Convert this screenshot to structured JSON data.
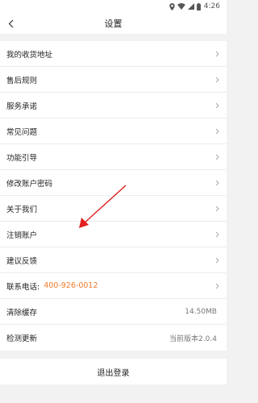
{
  "status_bar": {
    "time": "4:26"
  },
  "header": {
    "title": "设置"
  },
  "rows": [
    {
      "label": "我的收货地址"
    },
    {
      "label": "售后规则"
    },
    {
      "label": "服务承诺"
    },
    {
      "label": "常见问题"
    },
    {
      "label": "功能引导"
    },
    {
      "label": "修改账户密码"
    },
    {
      "label": "关于我们"
    },
    {
      "label": "注销账户"
    },
    {
      "label": "建议反馈"
    },
    {
      "label": "联系电话:",
      "phone": "400-926-0012"
    },
    {
      "label": "清除缓存",
      "value": "14.50MB"
    },
    {
      "label": "检测更新",
      "value": "当前版本2.0.4"
    }
  ],
  "logout_label": "退出登录",
  "colors": {
    "accent": "#f07b2c",
    "annotation_arrow": "#e02020"
  }
}
